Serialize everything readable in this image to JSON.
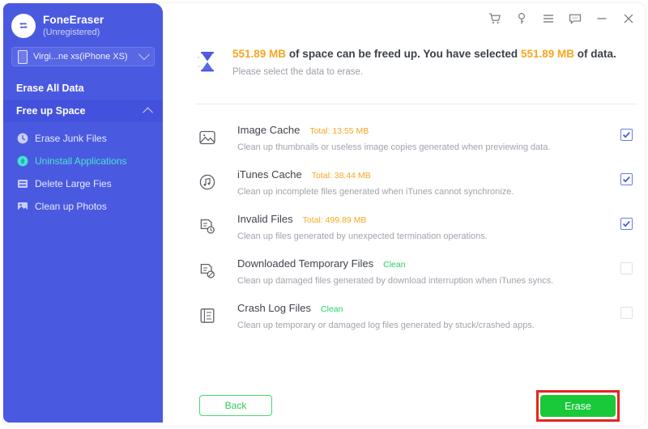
{
  "app": {
    "brand_name": "FoneEraser",
    "brand_status": "(Unregistered)",
    "logo_icon": "foneeraser-logo-icon"
  },
  "sidebar": {
    "device": {
      "label": "Virgi...ne xs(iPhone XS)",
      "icon": "phone-icon",
      "chevron": "chevron-down-icon"
    },
    "sections": [
      {
        "label": "Erase All Data",
        "active": false,
        "collapsible": false
      },
      {
        "label": "Free up Space",
        "active": true,
        "collapsible": true,
        "caret": "caret-up-icon"
      }
    ],
    "items": [
      {
        "label": "Erase Junk Files",
        "icon": "clock-icon",
        "selected": false
      },
      {
        "label": "Uninstall Applications",
        "icon": "uninstall-icon",
        "selected": true
      },
      {
        "label": "Delete Large Fies",
        "icon": "list-icon",
        "selected": false
      },
      {
        "label": "Clean up Photos",
        "icon": "photo-icon",
        "selected": false
      }
    ]
  },
  "titlebar": {
    "buttons": [
      {
        "name": "cart-icon",
        "glyph": "cart"
      },
      {
        "name": "key-icon",
        "glyph": "key"
      },
      {
        "name": "menu-icon",
        "glyph": "menu"
      },
      {
        "name": "chat-icon",
        "glyph": "chat"
      },
      {
        "name": "minimize-icon",
        "glyph": "minimize"
      },
      {
        "name": "close-icon",
        "glyph": "close"
      }
    ]
  },
  "banner": {
    "icon": "hourglass-icon",
    "freeable_size": "551.89 MB",
    "selected_size": "551.89 MB",
    "text_part1": "of space can be freed up. You have selected",
    "text_part2": "of data.",
    "subtitle": "Please select the data to erase."
  },
  "list": [
    {
      "title": "Image Cache",
      "total_label": "Total: 13.55 MB",
      "status_label": "",
      "description": "Clean up thumbnails or useless image copies generated when previewing data.",
      "icon": "image-icon",
      "checked": true
    },
    {
      "title": "iTunes Cache",
      "total_label": "Total: 38.44 MB",
      "status_label": "",
      "description": "Clean up incomplete files generated when iTunes cannot synchronize.",
      "icon": "music-note-icon",
      "checked": true
    },
    {
      "title": "Invalid Files",
      "total_label": "Total: 499.89 MB",
      "status_label": "",
      "description": "Clean up files generated by unexpected termination operations.",
      "icon": "file-clock-icon",
      "checked": true
    },
    {
      "title": "Downloaded Temporary Files",
      "total_label": "",
      "status_label": "Clean",
      "description": "Clean up damaged files generated by download interruption when iTunes syncs.",
      "icon": "file-blocked-icon",
      "checked": false
    },
    {
      "title": "Crash Log Files",
      "total_label": "",
      "status_label": "Clean",
      "description": "Clean up temporary or damaged log files generated by stuck/crashed apps.",
      "icon": "document-list-icon",
      "checked": false
    }
  ],
  "footer": {
    "back_label": "Back",
    "erase_label": "Erase"
  },
  "colors": {
    "sidebar_bg": "#4a5ae0",
    "accent_orange": "#f6a622",
    "accent_green": "#25d366",
    "erase_green": "#18c939",
    "highlight_red": "#e8231e",
    "selected_cyan": "#46e3d0"
  }
}
